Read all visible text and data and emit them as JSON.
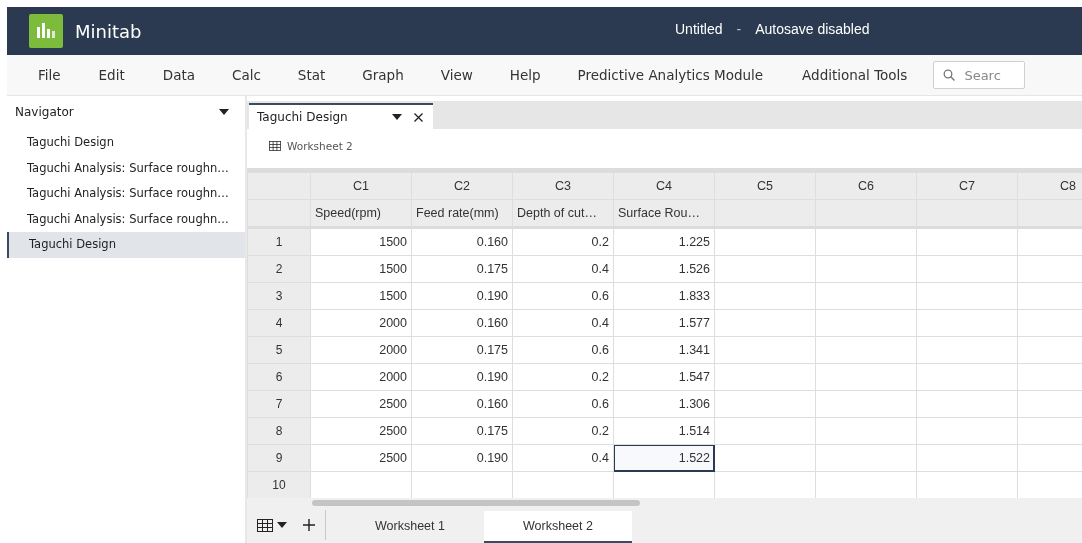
{
  "app": {
    "name": "Minitab"
  },
  "title_bar": {
    "document": "Untitled",
    "separator": "-",
    "autosave": "Autosave disabled"
  },
  "menu": [
    {
      "label": "File"
    },
    {
      "label": "Edit"
    },
    {
      "label": "Data"
    },
    {
      "label": "Calc"
    },
    {
      "label": "Stat"
    },
    {
      "label": "Graph"
    },
    {
      "label": "View"
    },
    {
      "label": "Help"
    },
    {
      "label": "Predictive Analytics Module"
    },
    {
      "label": "Additional Tools"
    }
  ],
  "search": {
    "placeholder": "Searc"
  },
  "navigator": {
    "title": "Navigator",
    "items": [
      {
        "label": "Taguchi Design",
        "selected": false
      },
      {
        "label": "Taguchi Analysis: Surface roughn…",
        "selected": false
      },
      {
        "label": "Taguchi Analysis: Surface roughn…",
        "selected": false
      },
      {
        "label": "Taguchi Analysis: Surface roughn…",
        "selected": false
      },
      {
        "label": "Taguchi Design",
        "selected": true
      }
    ]
  },
  "doc_tabs": [
    {
      "label": "Taguchi Design",
      "selected": true
    }
  ],
  "worksheet_link": "Worksheet 2",
  "sheet": {
    "columns": [
      {
        "id": "C1",
        "name": "Speed(rpm)"
      },
      {
        "id": "C2",
        "name": "Feed rate(mm)"
      },
      {
        "id": "C3",
        "name": "Depth of cut…"
      },
      {
        "id": "C4",
        "name": "Surface Rou…"
      },
      {
        "id": "C5"
      },
      {
        "id": "C6"
      },
      {
        "id": "C7"
      },
      {
        "id": "C8"
      }
    ],
    "rows": [
      {
        "number": "1",
        "cells": [
          {
            "value": "1500",
            "selected": false
          },
          {
            "value": "0.160",
            "selected": false
          },
          {
            "value": "0.2",
            "selected": false
          },
          {
            "value": "1.225",
            "selected": false
          }
        ]
      },
      {
        "number": "2",
        "cells": [
          {
            "value": "1500",
            "selected": false
          },
          {
            "value": "0.175",
            "selected": false
          },
          {
            "value": "0.4",
            "selected": false
          },
          {
            "value": "1.526",
            "selected": false
          }
        ]
      },
      {
        "number": "3",
        "cells": [
          {
            "value": "1500",
            "selected": false
          },
          {
            "value": "0.190",
            "selected": false
          },
          {
            "value": "0.6",
            "selected": false
          },
          {
            "value": "1.833",
            "selected": false
          }
        ]
      },
      {
        "number": "4",
        "cells": [
          {
            "value": "2000",
            "selected": false
          },
          {
            "value": "0.160",
            "selected": false
          },
          {
            "value": "0.4",
            "selected": false
          },
          {
            "value": "1.577",
            "selected": false
          }
        ]
      },
      {
        "number": "5",
        "cells": [
          {
            "value": "2000",
            "selected": false
          },
          {
            "value": "0.175",
            "selected": false
          },
          {
            "value": "0.6",
            "selected": false
          },
          {
            "value": "1.341",
            "selected": false
          }
        ]
      },
      {
        "number": "6",
        "cells": [
          {
            "value": "2000",
            "selected": false
          },
          {
            "value": "0.190",
            "selected": false
          },
          {
            "value": "0.2",
            "selected": false
          },
          {
            "value": "1.547",
            "selected": false
          }
        ]
      },
      {
        "number": "7",
        "cells": [
          {
            "value": "2500",
            "selected": false
          },
          {
            "value": "0.160",
            "selected": false
          },
          {
            "value": "0.6",
            "selected": false
          },
          {
            "value": "1.306",
            "selected": false
          }
        ]
      },
      {
        "number": "8",
        "cells": [
          {
            "value": "2500",
            "selected": false
          },
          {
            "value": "0.175",
            "selected": false
          },
          {
            "value": "0.2",
            "selected": false
          },
          {
            "value": "1.514",
            "selected": false
          }
        ]
      },
      {
        "number": "9",
        "cells": [
          {
            "value": "2500",
            "selected": false
          },
          {
            "value": "0.190",
            "selected": false
          },
          {
            "value": "0.4",
            "selected": false
          },
          {
            "value": "1.522",
            "selected": true
          }
        ]
      },
      {
        "number": "10"
      }
    ]
  },
  "worksheet_tabs": [
    {
      "label": "Worksheet 1",
      "selected": false
    },
    {
      "label": "Worksheet 2",
      "selected": true
    }
  ]
}
